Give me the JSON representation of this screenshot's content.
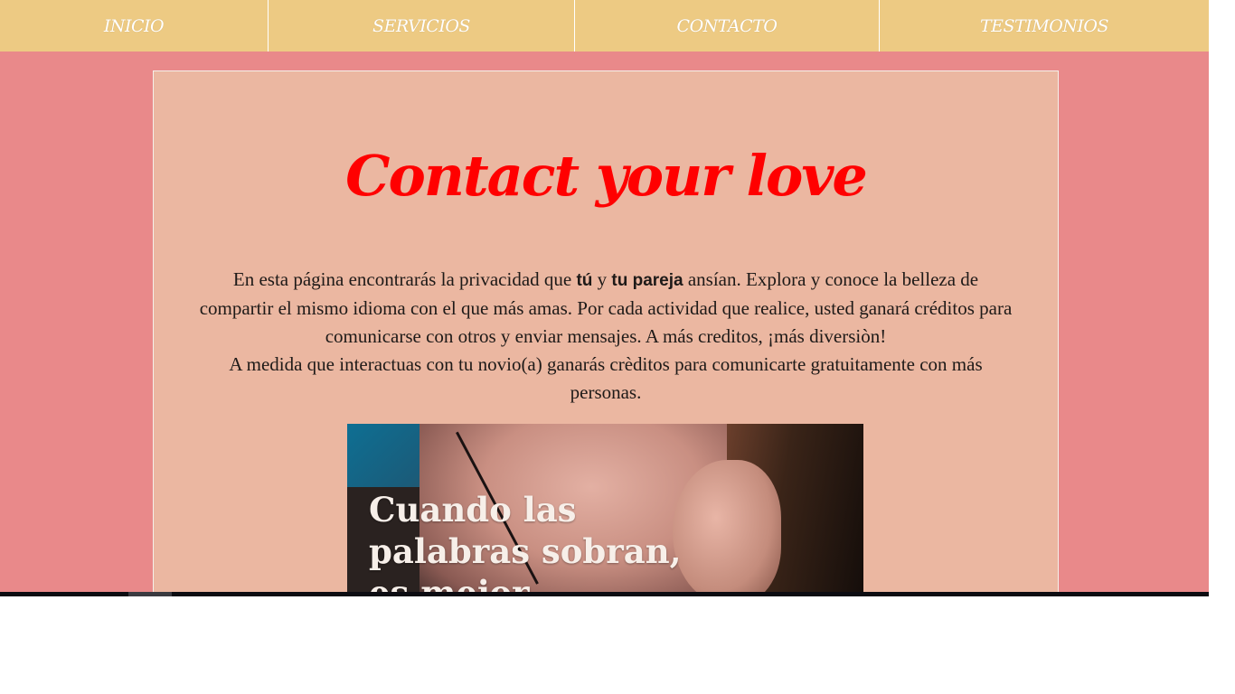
{
  "nav": {
    "items": [
      {
        "label": "INICIO"
      },
      {
        "label": "SERVICIOS"
      },
      {
        "label": "CONTACTO"
      },
      {
        "label": "TESTIMONIOS"
      }
    ]
  },
  "main": {
    "title": "Contact your love",
    "intro": {
      "p1_a": "En esta página encontrarás la privacidad que ",
      "p1_bold1": "tú",
      "p1_b": " y ",
      "p1_bold2": "tu pareja",
      "p1_c": " ansían. Explora y conoce la belleza de compartir el mismo idioma con el que más amas. Por cada actividad que realice, usted ganará créditos para comunicarse con otros y enviar mensajes. A más creditos, ¡más diversiòn!",
      "p2": "A medida que interactuas con tu novio(a) ganarás crèditos para comunicarte gratuitamente con más personas."
    },
    "hero": {
      "caption": "Cuando las\npalabras sobran,\nes mejor escuchar"
    }
  },
  "colors": {
    "page_bg": "#e9898a",
    "navbar_bg": "#edca83",
    "card_bg": "#ebb7a1",
    "title": "#ff0000"
  }
}
